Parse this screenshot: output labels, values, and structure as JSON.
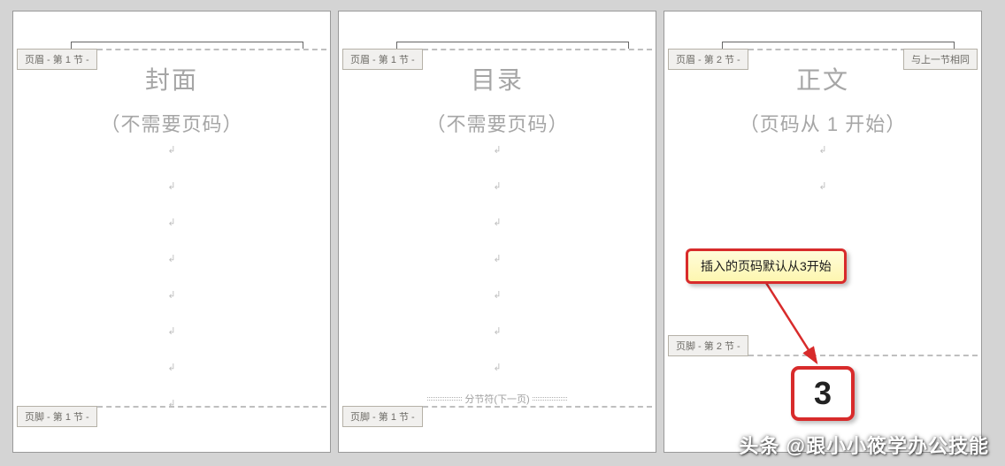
{
  "pages": [
    {
      "header_tag": "页眉 - 第 1 节 -",
      "footer_tag": "页脚 - 第 1 节 -",
      "same_as_prev": null,
      "title": "封面",
      "subtitle": "（不需要页码）",
      "section_break": null
    },
    {
      "header_tag": "页眉 - 第 1 节 -",
      "footer_tag": "页脚 - 第 1 节 -",
      "same_as_prev": null,
      "title": "目录",
      "subtitle": "（不需要页码）",
      "section_break": "分节符(下一页)"
    },
    {
      "header_tag": "页眉 - 第 2 节 -",
      "footer_tag": "页脚 - 第 2 节 -",
      "same_as_prev": "与上一节相同",
      "title": "正文",
      "subtitle": "（页码从 1 开始）",
      "section_break": null
    }
  ],
  "annotation": "插入的页码默认从3开始",
  "page_number": "3",
  "watermark": "头条 @跟小小筱学办公技能"
}
